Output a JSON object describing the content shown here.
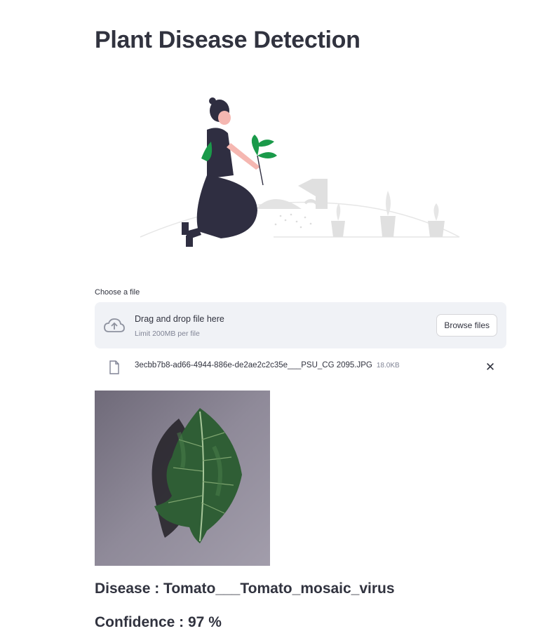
{
  "page": {
    "title": "Plant Disease Detection"
  },
  "uploader": {
    "label": "Choose a file",
    "dropzone_title": "Drag and drop file here",
    "dropzone_limit": "Limit 200MB per file",
    "browse_label": "Browse files",
    "file": {
      "name": "3ecbb7b8-ad66-4944-886e-de2ae2c2c35e___PSU_CG 2095.JPG",
      "size": "18.0KB"
    },
    "remove_icon": "close-icon"
  },
  "result": {
    "disease": "Disease : Tomato___Tomato_mosaic_virus",
    "confidence": "Confidence : 97 %"
  },
  "colors": {
    "accent_green": "#1a9a4a",
    "text": "#31333f",
    "dropzone_bg": "#f0f2f6"
  }
}
